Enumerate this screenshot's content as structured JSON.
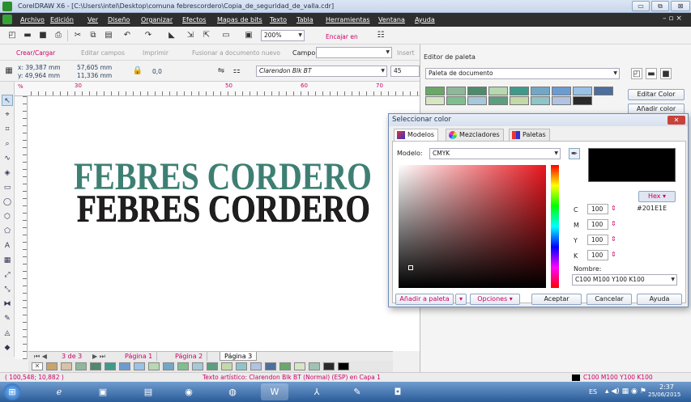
{
  "window": {
    "title": "CorelDRAW X6 - [C:\\Users\\intel\\Desktop\\comuna febrescordero\\Copia_de_seguridad_de_valla.cdr]",
    "minimize": "▭",
    "restore": "⧉",
    "close": "⊠"
  },
  "menu": {
    "items": [
      "Archivo",
      "Edición",
      "Ver",
      "Diseño",
      "Organizar",
      "Efectos",
      "Mapas de bits",
      "Texto",
      "Tabla",
      "Herramientas",
      "Ventana",
      "Ayuda"
    ],
    "right_controls": "– ▫ ×"
  },
  "std_toolbar": {
    "zoom": "200%",
    "snap": "Encajar en"
  },
  "field_toolbar": {
    "create_load": "Crear/Cargar",
    "edit_fields": "Editar campos",
    "print": "Imprimir",
    "merge": "Fusionar a documento nuevo",
    "field_label": "Campo:",
    "insert": "Insert"
  },
  "properties": {
    "x": "x: 39,387 mm",
    "y": "y: 49,964 mm",
    "width": "57,605 mm",
    "height": "11,336 mm",
    "rotation": "0,0",
    "font": "Clarendon Blk BT",
    "size": "45"
  },
  "ruler": {
    "unit": "%",
    "ticks": [
      "30",
      "50",
      "60",
      "70"
    ]
  },
  "artwork": {
    "main_text": "FEBRES CORDERO",
    "shadow_color": "#3e7f73",
    "text_color": "#201e1e"
  },
  "docker": {
    "title": "Editor de paleta",
    "palette_combo": "Paleta de documento",
    "edit_color": "Editar Color",
    "add_color": "Añadir color",
    "swatches": [
      "#6aa86a",
      "#8fb89a",
      "#4f8a6c",
      "#b8d8b0",
      "#3f9a8a",
      "#72a6c4",
      "#6c9bd1",
      "#9ac2e4",
      "#4c6f9c",
      "#d6e6c4",
      "#7fbf8f",
      "#a6c8d8",
      "#5e9e7e",
      "#c4d8a8",
      "#8fc4c8",
      "#b2c2e2",
      "#2a2a2a"
    ]
  },
  "dialog": {
    "title": "Seleccionar color",
    "close": "✕",
    "tabs": [
      "Modelos",
      "Mezcladores",
      "Paletas"
    ],
    "model_label": "Modelo:",
    "model_value": "CMYK",
    "preview_color": "#000000",
    "hex_mode": "Hex",
    "hex_value": "#201E1E",
    "cmyk": [
      {
        "k": "C",
        "v": "100"
      },
      {
        "k": "M",
        "v": "100"
      },
      {
        "k": "Y",
        "v": "100"
      },
      {
        "k": "K",
        "v": "100"
      }
    ],
    "name_label": "Nombre:",
    "name_value": "C100 M100 Y100 K100",
    "add_palette": "Añadir a paleta",
    "options": "Opciones",
    "accept": "Aceptar",
    "cancel": "Cancelar",
    "help": "Ayuda"
  },
  "pages": {
    "counter": "3 de 3",
    "tabs": [
      "Página 1",
      "Página 2",
      "Página 3"
    ],
    "active": "Página 3"
  },
  "statusbar": {
    "coords": "( 100,548; 10,882 )",
    "info": "Texto artístico: Clarendon Blk BT (Normal) (ESP) en Capa 1",
    "fill": "C100 M100 Y100 K100"
  },
  "taskbar": {
    "lang": "ES",
    "time": "2:37",
    "date": "25/06/2015"
  }
}
